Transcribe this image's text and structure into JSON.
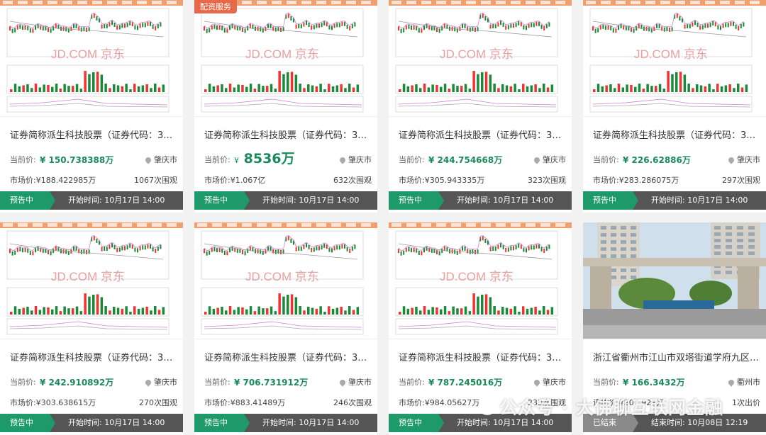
{
  "cards": [
    {
      "title": "证券简称派生科技股票（证券代码：300...",
      "price_label": "当前价:",
      "price": "¥ 150.738388万",
      "big": false,
      "location": "肇庆市",
      "market": "市场价:¥188.422985万",
      "views": "1067次围观",
      "status": "预告中",
      "time": "开始时间: 10月17日 14:00",
      "tag": "",
      "image": "chart"
    },
    {
      "title": "证券简称派生科技股票（证券代码：300...",
      "price_label": "当前价:",
      "price_prefix": "¥",
      "price": "8536万",
      "big": true,
      "location": "肇庆市",
      "market": "市场价:¥1.067亿",
      "views": "632次围观",
      "status": "预告中",
      "time": "开始时间: 10月17日 14:00",
      "tag": "配资服务",
      "image": "chart"
    },
    {
      "title": "证券简称派生科技股票（证券代码：300...",
      "price_label": "当前价:",
      "price": "¥ 244.754668万",
      "big": false,
      "location": "肇庆市",
      "market": "市场价:¥305.943335万",
      "views": "323次围观",
      "status": "预告中",
      "time": "开始时间: 10月17日 14:00",
      "tag": "",
      "image": "chart"
    },
    {
      "title": "证券简称派生科技股票（证券代码：300...",
      "price_label": "当前价:",
      "price": "¥ 226.62886万",
      "big": false,
      "location": "肇庆市",
      "market": "市场价:¥283.286075万",
      "views": "297次围观",
      "status": "预告中",
      "time": "开始时间: 10月17日 14:00",
      "tag": "",
      "image": "chart"
    },
    {
      "title": "证券简称派生科技股票（证券代码：300...",
      "price_label": "当前价:",
      "price": "¥ 242.910892万",
      "big": false,
      "location": "肇庆市",
      "market": "市场价:¥303.638615万",
      "views": "270次围观",
      "status": "预告中",
      "time": "开始时间: 10月17日 14:00",
      "tag": "",
      "image": "chart"
    },
    {
      "title": "证券简称派生科技股票（证券代码：300...",
      "price_label": "当前价:",
      "price": "¥ 706.731912万",
      "big": false,
      "location": "肇庆市",
      "market": "市场价:¥883.41489万",
      "views": "246次围观",
      "status": "预告中",
      "time": "开始时间: 10月17日 14:00",
      "tag": "",
      "image": "chart"
    },
    {
      "title": "证券简称派生科技股票（证券代码：300...",
      "price_label": "当前价:",
      "price": "¥ 787.245016万",
      "big": false,
      "location": "肇庆市",
      "market": "市场价:¥984.05627万",
      "views": "233次围观",
      "status": "预告中",
      "time": "开始时间: 10月17日 14:00",
      "tag": "",
      "image": "chart"
    },
    {
      "title": "浙江省衢州市江山市双塔街道学府九区1...",
      "price_label": "当前价:",
      "price": "¥ 166.3432万",
      "big": false,
      "location": "衢州市",
      "market": "评估价:¥207.929万",
      "views": "1次出价",
      "status": "已结束",
      "time": "结束时间: 10月08日 12:19",
      "tag": "",
      "image": "building"
    }
  ],
  "watermark": "公众号 · 大佛聊互联网金融",
  "chart_watermark": "JD.COM 京东",
  "colors": {
    "accent": "#1e9a6a",
    "price": "#1a8a5a",
    "bar": "#555555",
    "tag": "#e8694a"
  }
}
